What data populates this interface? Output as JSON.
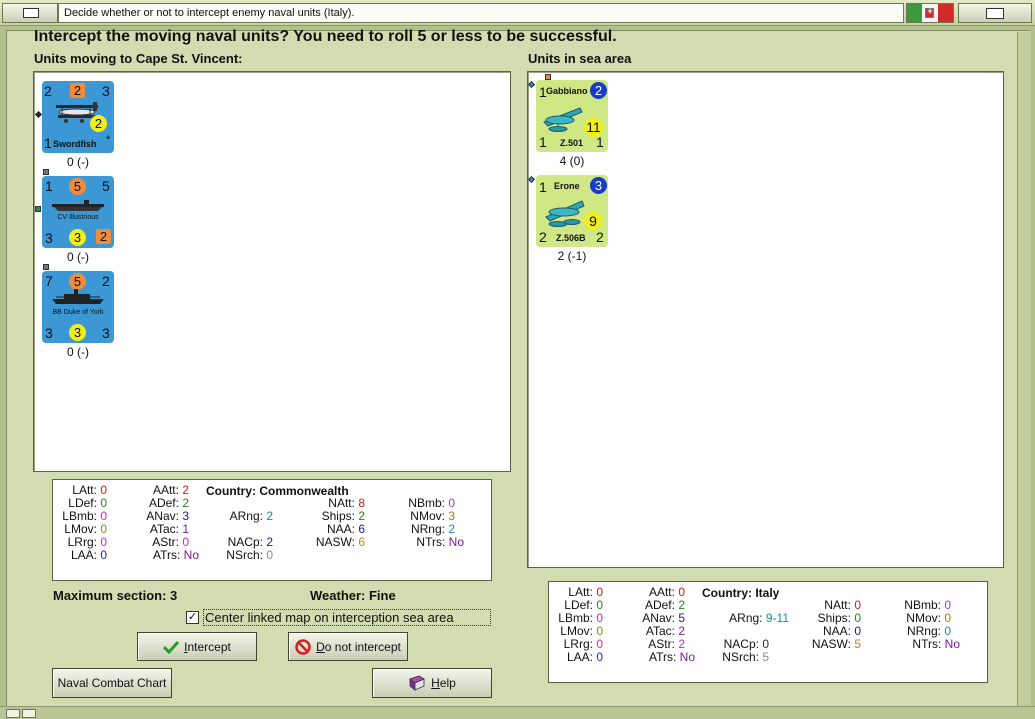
{
  "window": {
    "title": "Decide whether or not to intercept enemy naval units (Italy)."
  },
  "heading": "Intercept the moving naval units?  You need to roll 5 or less to be successful.",
  "left_panel": {
    "title": "Units moving to Cape St. Vincent:",
    "units": [
      {
        "name": "Swordfish",
        "tl": "2",
        "tc": "2",
        "tr": "3",
        "mid": "2",
        "bl": "1",
        "star": "*",
        "caption": "0 (-)"
      },
      {
        "name": "CV Illustrious",
        "tl": "1",
        "tc": "5",
        "tr": "5",
        "bl": "3",
        "bc": "3",
        "br": "2",
        "caption": "0 (-)"
      },
      {
        "name": "BB Duke of York",
        "tl": "7",
        "tc": "5",
        "tr": "2",
        "bl": "3",
        "bc": "3",
        "br": "3",
        "caption": "0 (-)"
      }
    ]
  },
  "right_panel": {
    "title": "Units in sea area",
    "units": [
      {
        "name": "Gabbiano",
        "model": "Z.501",
        "tl": "1",
        "tr": "2",
        "mid": "11",
        "bl": "1",
        "br": "1",
        "caption": "4 (0)"
      },
      {
        "name": "Erone",
        "model": "Z.506B",
        "tl": "1",
        "tr": "3",
        "mid": "9",
        "bl": "2",
        "br": "2",
        "caption": "2 (-1)"
      }
    ]
  },
  "stats_left": {
    "country": "Country: Commonwealth",
    "items": [
      {
        "k": "LAtt:",
        "v": "0"
      },
      {
        "k": "LDef:",
        "v": "0"
      },
      {
        "k": "LBmb:",
        "v": "0"
      },
      {
        "k": "LMov:",
        "v": "0"
      },
      {
        "k": "LRrg:",
        "v": "0"
      },
      {
        "k": "LAA:",
        "v": "0"
      },
      {
        "k": "AAtt:",
        "v": "2"
      },
      {
        "k": "ADef:",
        "v": "2"
      },
      {
        "k": "ANav:",
        "v": "3"
      },
      {
        "k": "ATac:",
        "v": "1"
      },
      {
        "k": "AStr:",
        "v": "0"
      },
      {
        "k": "ATrs:",
        "v": "No"
      },
      {
        "k": "ARng:",
        "v": "2"
      },
      {
        "k": "NACp:",
        "v": "2"
      },
      {
        "k": "NSrch:",
        "v": "0"
      },
      {
        "k": "NAtt:",
        "v": "8"
      },
      {
        "k": "Ships:",
        "v": "2"
      },
      {
        "k": "NAA:",
        "v": "6"
      },
      {
        "k": "NASW:",
        "v": "6"
      },
      {
        "k": "NBmb:",
        "v": "0"
      },
      {
        "k": "NMov:",
        "v": "3"
      },
      {
        "k": "NRng:",
        "v": "2"
      },
      {
        "k": "NTrs:",
        "v": "No"
      }
    ]
  },
  "stats_right": {
    "country": "Country: Italy",
    "items": [
      {
        "k": "LAtt:",
        "v": "0"
      },
      {
        "k": "LDef:",
        "v": "0"
      },
      {
        "k": "LBmb:",
        "v": "0"
      },
      {
        "k": "LMov:",
        "v": "0"
      },
      {
        "k": "LRrg:",
        "v": "0"
      },
      {
        "k": "LAA:",
        "v": "0"
      },
      {
        "k": "AAtt:",
        "v": "0"
      },
      {
        "k": "ADef:",
        "v": "2"
      },
      {
        "k": "ANav:",
        "v": "5"
      },
      {
        "k": "ATac:",
        "v": "2"
      },
      {
        "k": "AStr:",
        "v": "2"
      },
      {
        "k": "ATrs:",
        "v": "No"
      },
      {
        "k": "ARng:",
        "v": "9-11"
      },
      {
        "k": "NACp:",
        "v": "0"
      },
      {
        "k": "NSrch:",
        "v": "5"
      },
      {
        "k": "NAtt:",
        "v": "0"
      },
      {
        "k": "Ships:",
        "v": "0"
      },
      {
        "k": "NAA:",
        "v": "0"
      },
      {
        "k": "NASW:",
        "v": "5"
      },
      {
        "k": "NBmb:",
        "v": "0"
      },
      {
        "k": "NMov:",
        "v": "0"
      },
      {
        "k": "NRng:",
        "v": "0"
      },
      {
        "k": "NTrs:",
        "v": "No"
      }
    ]
  },
  "info": {
    "max_section": "Maximum section: 3",
    "weather": "Weather:  Fine"
  },
  "checkbox": {
    "label": "Center linked map on interception sea area",
    "checked_glyph": "✓"
  },
  "buttons": {
    "intercept_first": "I",
    "intercept_rest": "ntercept",
    "no_intercept_first": "D",
    "no_intercept_rest": "o not intercept",
    "naval_chart": "Naval Combat Chart",
    "help_first": "H",
    "help_rest": "elp"
  },
  "colors": {
    "counter_blue": "#3b98d4",
    "counter_green": "#cfe784",
    "window_bg": "#d2dcb0"
  }
}
